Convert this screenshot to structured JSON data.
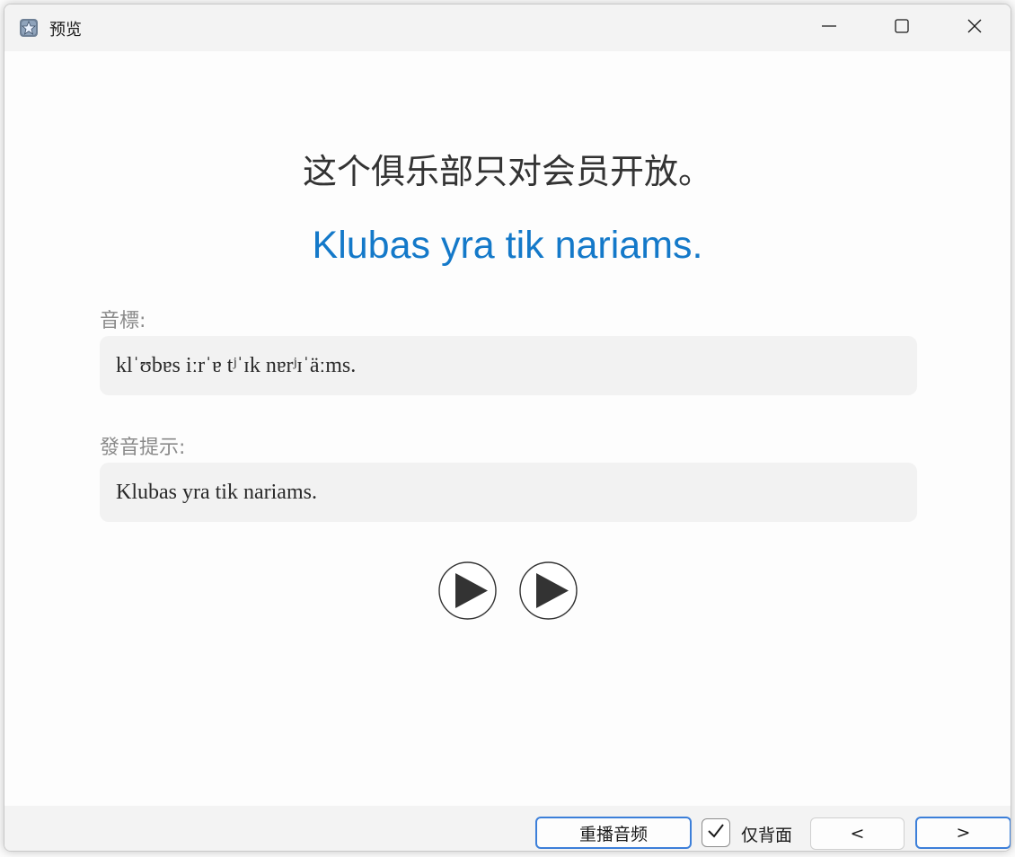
{
  "window": {
    "title": "预览",
    "icons": {
      "app": "anki-star-icon",
      "minimize": "minimize-icon",
      "maximize": "maximize-icon",
      "close": "close-icon"
    }
  },
  "card": {
    "front_text": "这个俱乐部只对会员开放。",
    "back_text": "Klubas yra tik nariams.",
    "back_color": "#1479c9",
    "fields": [
      {
        "label": "音標:",
        "value": "klˈʊbɐs iːrˈɐ tʲˈɪk nɐrʲɪˈäːms."
      },
      {
        "label": "發音提示:",
        "value": "Klubas yra tik nariams."
      }
    ],
    "audio_buttons": [
      "play-icon",
      "play-icon"
    ]
  },
  "footer": {
    "replay_label": "重播音频",
    "back_only_label": "仅背面",
    "back_only_checked": true,
    "prev_label": "<",
    "next_label": ">"
  },
  "accent_color": "#3c7fd9"
}
